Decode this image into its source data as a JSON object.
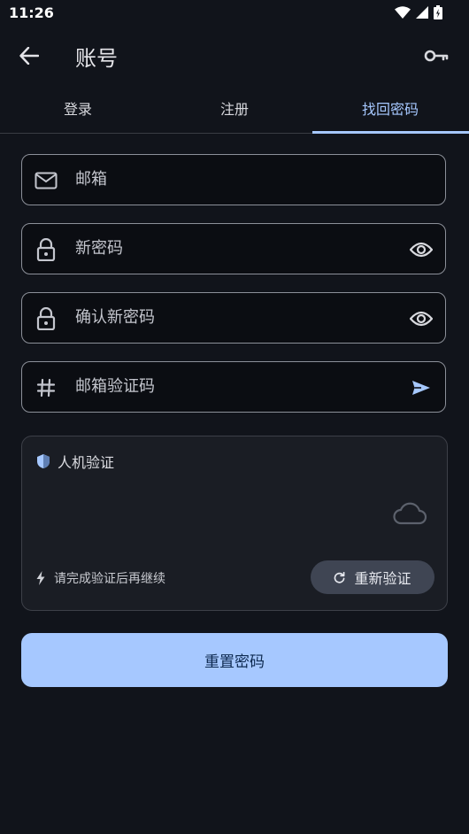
{
  "status_bar": {
    "time": "11:26"
  },
  "app_bar": {
    "title": "账号"
  },
  "tabs": [
    {
      "label": "登录"
    },
    {
      "label": "注册"
    },
    {
      "label": "找回密码"
    }
  ],
  "form": {
    "email": {
      "placeholder": "邮箱",
      "value": ""
    },
    "new_password": {
      "placeholder": "新密码",
      "value": ""
    },
    "confirm_password": {
      "placeholder": "确认新密码",
      "value": ""
    },
    "email_code": {
      "placeholder": "邮箱验证码",
      "value": ""
    }
  },
  "captcha": {
    "title": "人机验证",
    "hint": "请完成验证后再继续",
    "reverify_label": "重新验证"
  },
  "submit": {
    "label": "重置密码"
  },
  "colors": {
    "background": "#11141b",
    "accent": "#a6c8ff",
    "outline": "#8c9099",
    "card": "#1a1d24"
  }
}
